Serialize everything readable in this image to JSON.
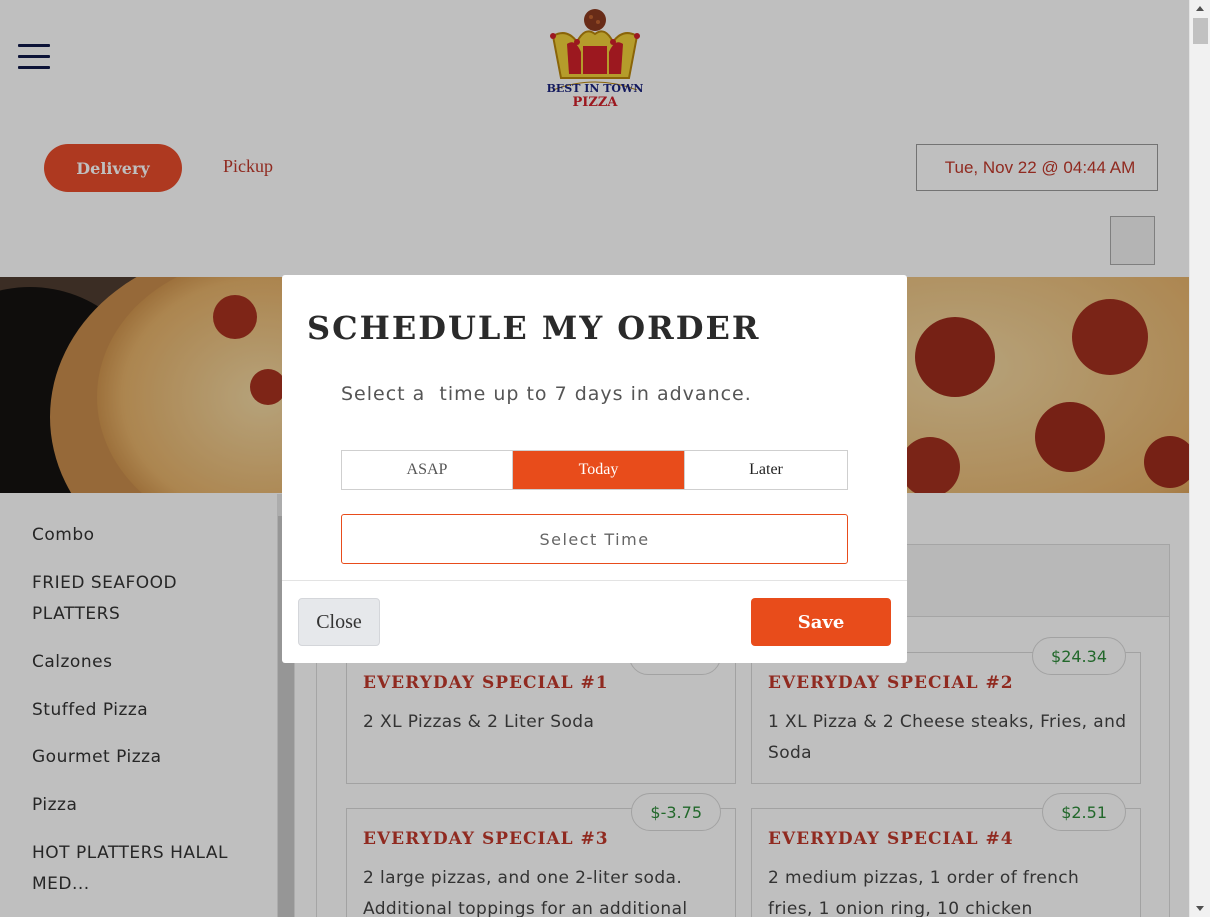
{
  "header": {
    "logo_text": "BEST IN TOWN PIZZA",
    "delivery_label": "Delivery",
    "pickup_label": "Pickup",
    "schedule_datetime": "Tue, Nov 22 @ 04:44 AM",
    "calendar_glyph": "",
    "cart_glyph": ""
  },
  "sidebar": {
    "categories": [
      "Combo",
      "FRIED SEAFOOD PLATTERS",
      "Calzones",
      "Stuffed Pizza",
      "Gourmet Pizza",
      "Pizza",
      "HOT PLATTERS HALAL MED..."
    ]
  },
  "menu": {
    "items": [
      {
        "title": "EVERYDAY SPECIAL #1",
        "description": "2 XL Pizzas & 2 Liter Soda",
        "price": ""
      },
      {
        "title": "EVERYDAY SPECIAL #2",
        "description": "1 XL Pizza & 2 Cheese steaks, Fries, and Soda",
        "price": "$24.34"
      },
      {
        "title": "EVERYDAY SPECIAL #3",
        "description": "2 large pizzas, and one 2-liter soda. Additional toppings for an additional",
        "price": "$-3.75"
      },
      {
        "title": "EVERYDAY SPECIAL #4",
        "description": "2 medium pizzas, 1 order of french fries, 1 onion ring, 10 chicken",
        "price": "$2.51"
      }
    ]
  },
  "modal": {
    "title": "SCHEDULE MY ORDER",
    "subtitle": "Select a  time up to 7 days in advance.",
    "options": [
      "ASAP",
      "Today",
      "Later"
    ],
    "selected_option": "Today",
    "select_time_placeholder": "Select Time",
    "close_label": "Close",
    "save_label": "Save"
  },
  "colors": {
    "accent": "#e84c1b",
    "price_green": "#2e8b3a",
    "title_red": "#c0392b"
  }
}
